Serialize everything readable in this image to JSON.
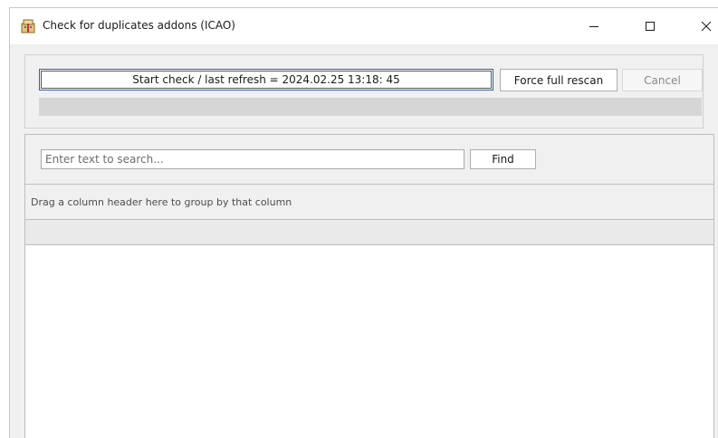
{
  "window": {
    "title": "Check for duplicates addons (ICAO)",
    "app_icon": "addon-package-icon",
    "controls": {
      "minimize_icon": "minimize-icon",
      "maximize_icon": "maximize-icon",
      "close_icon": "close-icon"
    }
  },
  "toolbar": {
    "start_label": "Start check / last refresh = 2024.02.25 13:18: 45",
    "force_label": "Force full rescan",
    "cancel_label": "Cancel",
    "progress": 0
  },
  "search": {
    "placeholder": "Enter text to search...",
    "value": "",
    "find_label": "Find"
  },
  "grid": {
    "group_hint": "Drag a column header here to group by that column",
    "columns": [],
    "rows": []
  },
  "colors": {
    "focus_border": "#2f5bb7",
    "panel_bg": "#f0f0f0",
    "progress_track": "#d6d6d6"
  }
}
